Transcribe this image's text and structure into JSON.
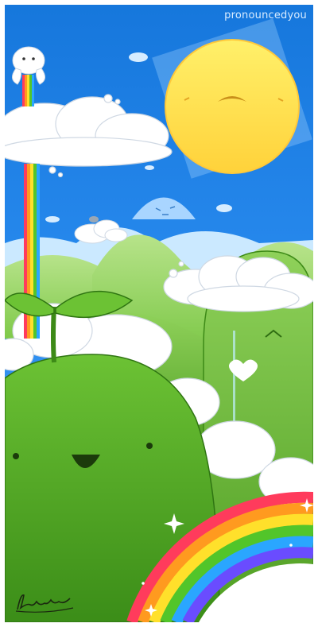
{
  "watermark": {
    "text": "pronouncedyou"
  },
  "colors": {
    "sky": "#1a7fe0",
    "sun": "#ffe254",
    "hill_green": "#62b52c",
    "hill_light": "#8fd060",
    "cloud": "#ffffff",
    "rainbow": [
      "#ff3b5c",
      "#ff9a1f",
      "#ffe02b",
      "#52c52a",
      "#2aa6ff",
      "#6a4cff"
    ]
  },
  "characters": [
    "sun",
    "bunny",
    "distant-hill-face",
    "tall-hill-face",
    "sprout-blob"
  ],
  "signature": {
    "text": "Lauren"
  }
}
